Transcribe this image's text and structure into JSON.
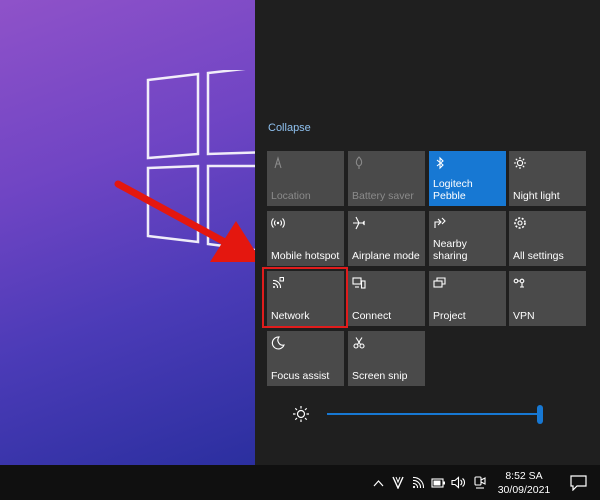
{
  "panel": {
    "collapse_label": "Collapse",
    "tiles": [
      {
        "label": "Location",
        "icon": "location-icon",
        "state": "disabled"
      },
      {
        "label": "Battery saver",
        "icon": "battery-saver-icon",
        "state": "disabled"
      },
      {
        "label": "Logitech Pebble",
        "icon": "bluetooth-icon",
        "state": "on"
      },
      {
        "label": "Night light",
        "icon": "night-light-icon",
        "state": "off"
      },
      {
        "label": "Mobile hotspot",
        "icon": "mobile-hotspot-icon",
        "state": "off"
      },
      {
        "label": "Airplane mode",
        "icon": "airplane-icon",
        "state": "off"
      },
      {
        "label": "Nearby sharing",
        "icon": "nearby-sharing-icon",
        "state": "off"
      },
      {
        "label": "All settings",
        "icon": "gear-icon",
        "state": "off"
      },
      {
        "label": "Network",
        "icon": "network-icon",
        "state": "off"
      },
      {
        "label": "Connect",
        "icon": "connect-icon",
        "state": "off"
      },
      {
        "label": "Project",
        "icon": "project-icon",
        "state": "off"
      },
      {
        "label": "VPN",
        "icon": "vpn-icon",
        "state": "off"
      },
      {
        "label": "Focus assist",
        "icon": "moon-icon",
        "state": "off"
      },
      {
        "label": "Screen snip",
        "icon": "screen-snip-icon",
        "state": "off"
      }
    ],
    "brightness": {
      "value_fraction": 1.0,
      "icon": "brightness-icon",
      "accent": "#1778d3"
    }
  },
  "taskbar": {
    "time": "8:52 SA",
    "date": "30/09/2021",
    "tray_icons": [
      "chevron-up-icon",
      "vector-app-icon",
      "wifi-icon",
      "battery-icon",
      "volume-icon",
      "meet-now-icon"
    ],
    "notification_icon": "notification-icon"
  },
  "colors": {
    "accent": "#1778d3",
    "tile": "#4a4a4a",
    "panel": "#1f1f1f",
    "highlight": "#e01c1c"
  }
}
